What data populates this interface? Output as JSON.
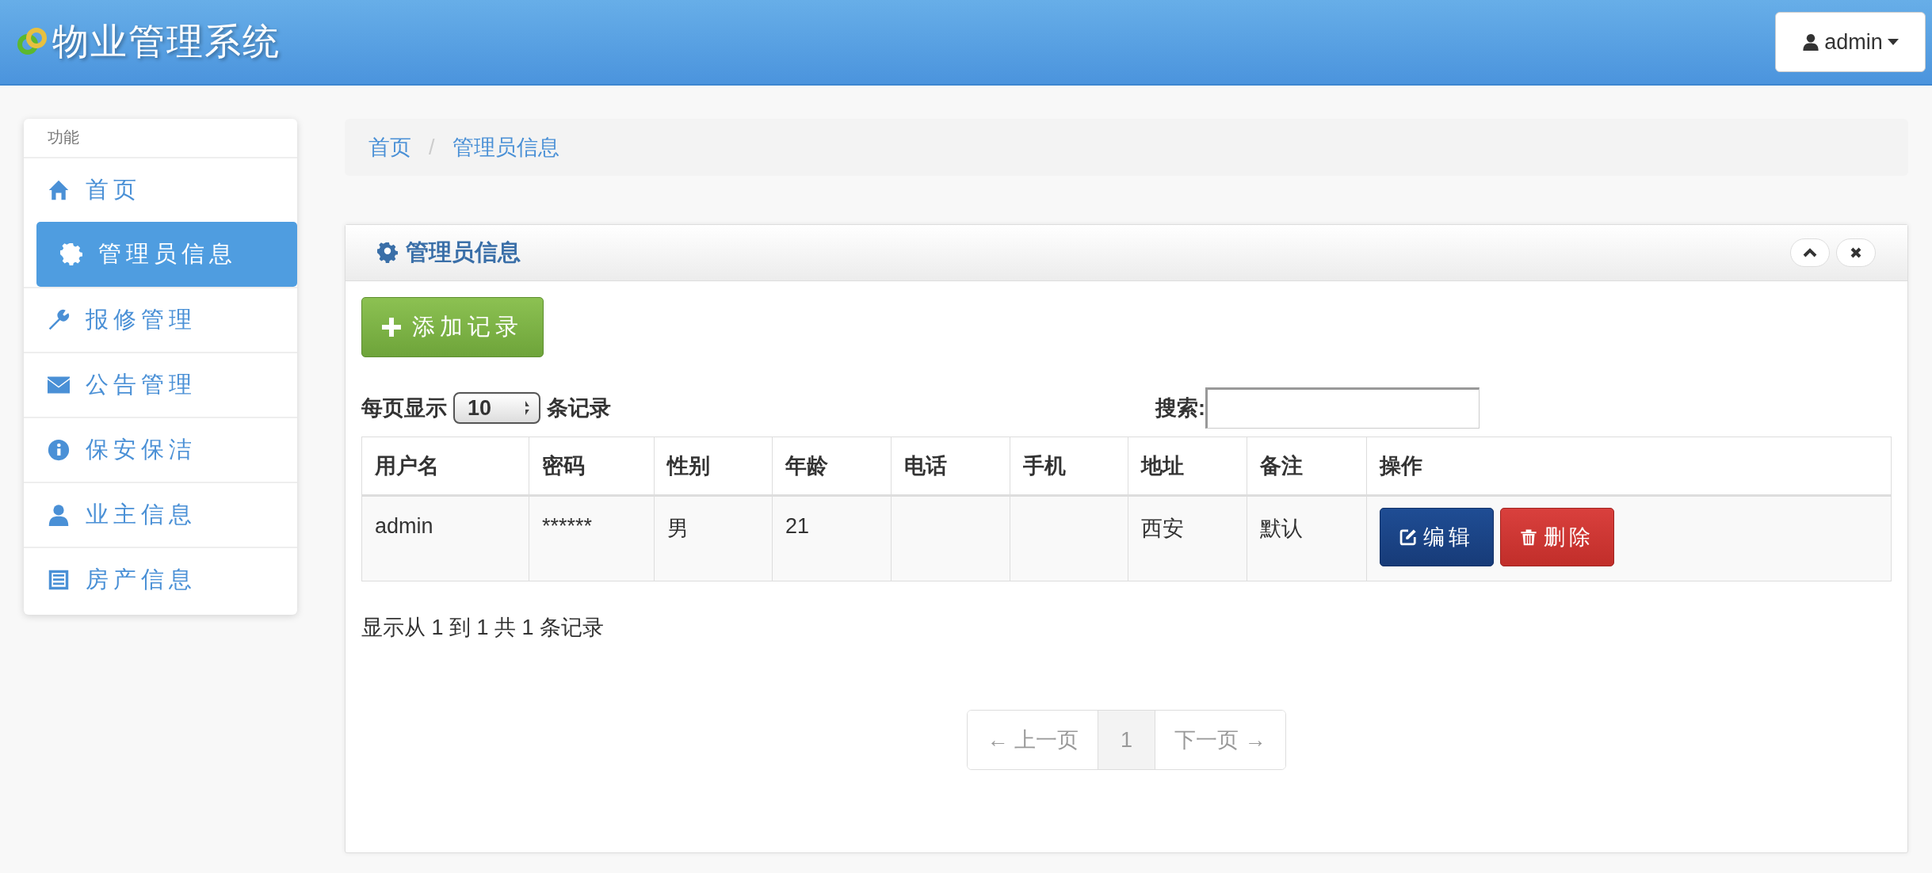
{
  "header": {
    "title": "物业管理系统",
    "user_menu": {
      "label": "admin"
    }
  },
  "sidebar": {
    "heading": "功能",
    "items": [
      {
        "label": "首页",
        "selected": false
      },
      {
        "label": "管理员信息",
        "selected": true
      },
      {
        "label": "报修管理",
        "selected": false
      },
      {
        "label": "公告管理",
        "selected": false
      },
      {
        "label": "保安保洁",
        "selected": false
      },
      {
        "label": "业主信息",
        "selected": false
      },
      {
        "label": "房产信息",
        "selected": false
      }
    ]
  },
  "breadcrumb": {
    "separator": "/",
    "items": [
      "首页",
      "管理员信息"
    ]
  },
  "panel": {
    "title": "管理员信息",
    "add_button": "添加记录",
    "page_size": {
      "before": "每页显示",
      "value": "10",
      "after": "条记录"
    },
    "search": {
      "label": "搜索:"
    },
    "table": {
      "columns": [
        "用户名",
        "密码",
        "性别",
        "年龄",
        "电话",
        "手机",
        "地址",
        "备注",
        "操作"
      ],
      "rows": [
        {
          "cells": [
            "admin",
            "******",
            "男",
            "21",
            "",
            "",
            "西安",
            "默认"
          ],
          "actions": [
            {
              "label": "编辑",
              "kind": "edit"
            },
            {
              "label": "删除",
              "kind": "delete"
            }
          ]
        }
      ]
    },
    "info": "显示从 1 到 1 共 1 条记录",
    "pagination": [
      {
        "label": "← 上一页",
        "selected": false,
        "disabled": true
      },
      {
        "label": "1",
        "selected": true,
        "disabled": false
      },
      {
        "label": "下一页 →",
        "selected": false,
        "disabled": true
      }
    ]
  }
}
